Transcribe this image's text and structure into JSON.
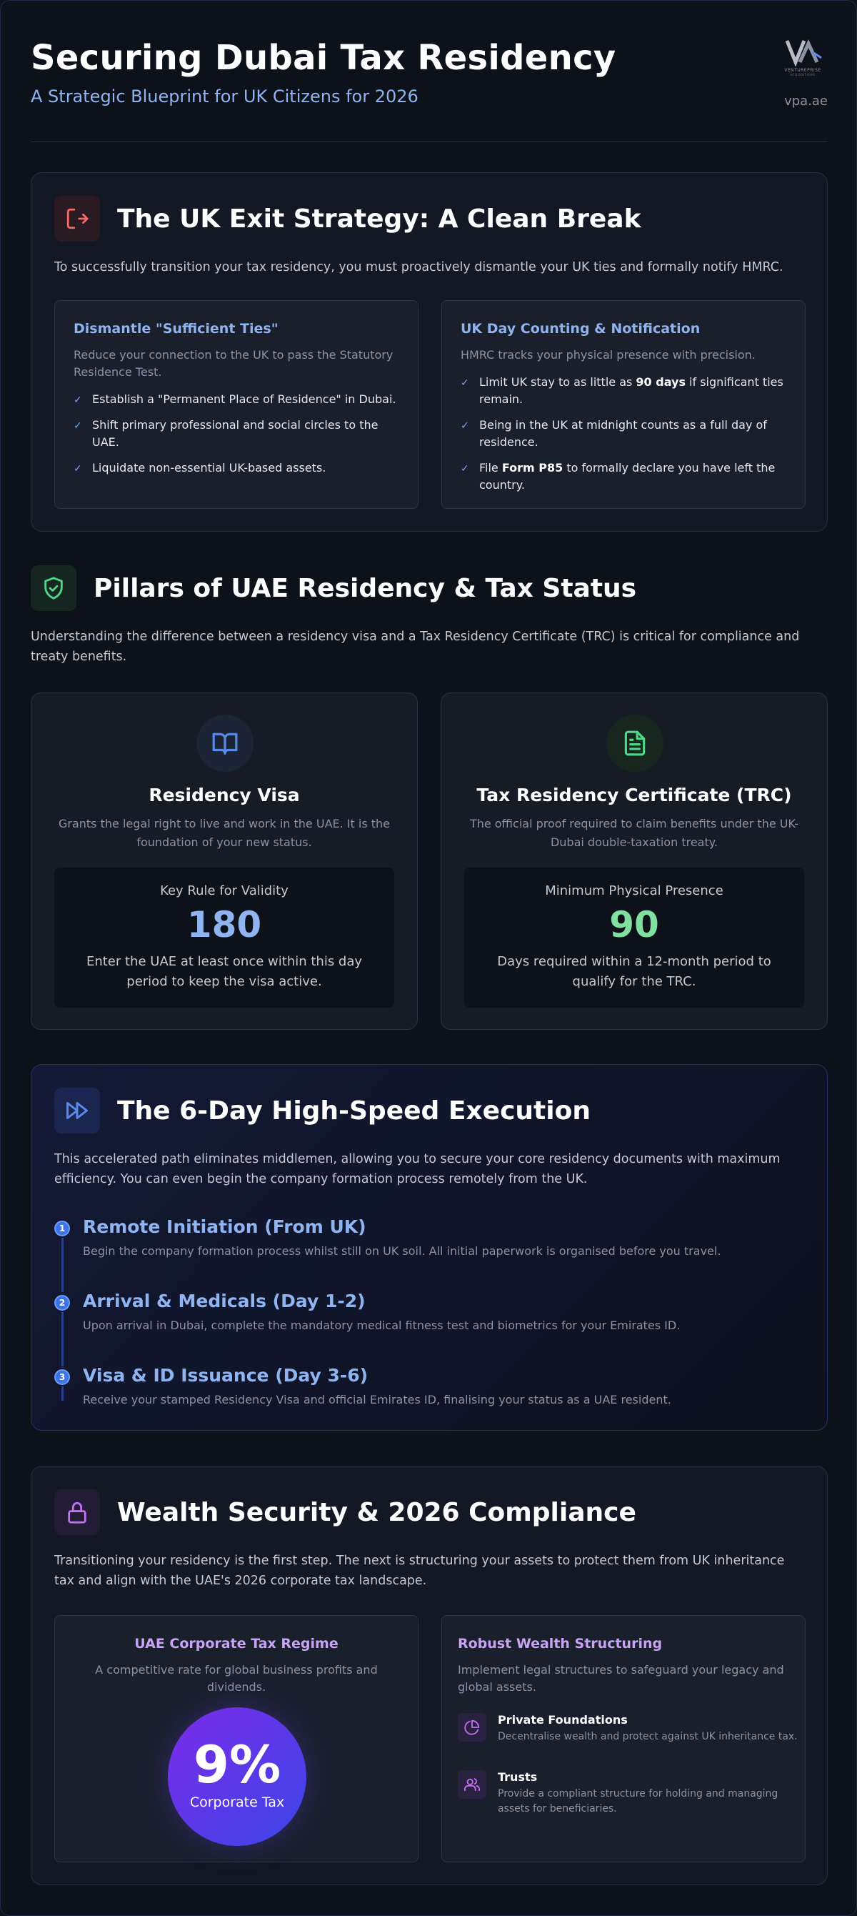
{
  "header": {
    "title": "Securing Dubai Tax Residency",
    "subtitle": "A Strategic Blueprint for UK Citizens for 2026",
    "brand_name": "VENTUREPRISE",
    "brand_sub": "ACQUISITIONS",
    "site": "vpa.ae"
  },
  "exit": {
    "icon": "logout-icon",
    "title": "The UK Exit Strategy: A Clean Break",
    "intro": "To successfully transition your tax residency, you must proactively dismantle your UK ties and formally notify HMRC.",
    "ties": {
      "title": "Dismantle \"Sufficient Ties\"",
      "desc": "Reduce your connection to the UK to pass the Statutory Residence Test.",
      "items": [
        "Establish a \"Permanent Place of Residence\" in Dubai.",
        "Shift primary professional and social circles to the UAE.",
        "Liquidate non-essential UK-based assets."
      ]
    },
    "counting": {
      "title": "UK Day Counting & Notification",
      "desc": "HMRC tracks your physical presence with precision.",
      "item1_pre": "Limit UK stay to as little as ",
      "item1_bold": "90 days",
      "item1_post": " if significant ties remain.",
      "item2": "Being in the UK at midnight counts as a full day of residence.",
      "item3_pre": "File ",
      "item3_bold": "Form P85",
      "item3_post": " to formally declare you have left the country."
    }
  },
  "pillars": {
    "title": "Pillars of UAE Residency & Tax Status",
    "intro": "Understanding the difference between a residency visa and a Tax Residency Certificate (TRC) is critical for compliance and treaty benefits.",
    "visa": {
      "icon": "open-book-icon",
      "title": "Residency Visa",
      "desc": "Grants the legal right to live and work in the UAE. It is the foundation of your new status.",
      "rule_label": "Key Rule for Validity",
      "rule_value": "180",
      "rule_desc": "Enter the UAE at least once within this day period to keep the visa active."
    },
    "trc": {
      "icon": "document-icon",
      "title": "Tax Residency Certificate (TRC)",
      "desc": "The official proof required to claim benefits under the UK-Dubai double-taxation treaty.",
      "rule_label": "Minimum Physical Presence",
      "rule_value": "90",
      "rule_desc": "Days required within a 12-month period to qualify for the TRC."
    }
  },
  "execution": {
    "icon": "fast-forward-icon",
    "title": "The 6-Day High-Speed Execution",
    "intro": "This accelerated path eliminates middlemen, allowing you to secure your core residency documents with maximum efficiency. You can even begin the company formation process remotely from the UK.",
    "steps": [
      {
        "num": "1",
        "title": "Remote Initiation (From UK)",
        "desc": "Begin the company formation process whilst still on UK soil. All initial paperwork is organised before you travel."
      },
      {
        "num": "2",
        "title": "Arrival & Medicals (Day 1-2)",
        "desc": "Upon arrival in Dubai, complete the mandatory medical fitness test and biometrics for your Emirates ID."
      },
      {
        "num": "3",
        "title": "Visa & ID Issuance (Day 3-6)",
        "desc": "Receive your stamped Residency Visa and official Emirates ID, finalising your status as a UAE resident."
      }
    ]
  },
  "wealth": {
    "icon": "lock-icon",
    "title": "Wealth Security & 2026 Compliance",
    "intro": "Transitioning your residency is the first step. The next is structuring your assets to protect them from UK inheritance tax and align with the UAE's 2026 corporate tax landscape.",
    "tax": {
      "title": "UAE Corporate Tax Regime",
      "desc": "A competitive rate for global business profits and dividends.",
      "rate": "9%",
      "rate_label": "Corporate Tax"
    },
    "structuring": {
      "title": "Robust Wealth Structuring",
      "desc": "Implement legal structures to safeguard your legacy and global assets.",
      "items": [
        {
          "icon": "pie-chart-icon",
          "title": "Private Foundations",
          "desc": "Decentralise wealth and protect against UK inheritance tax."
        },
        {
          "icon": "users-icon",
          "title": "Trusts",
          "desc": "Provide a compliant structure for holding and managing assets for beneficiaries."
        }
      ]
    }
  },
  "colors": {
    "accent_blue": "#8fb4f0",
    "accent_green": "#7fe0a0",
    "accent_purple": "#c9a4f5",
    "exit_red": "#f06b6b"
  }
}
